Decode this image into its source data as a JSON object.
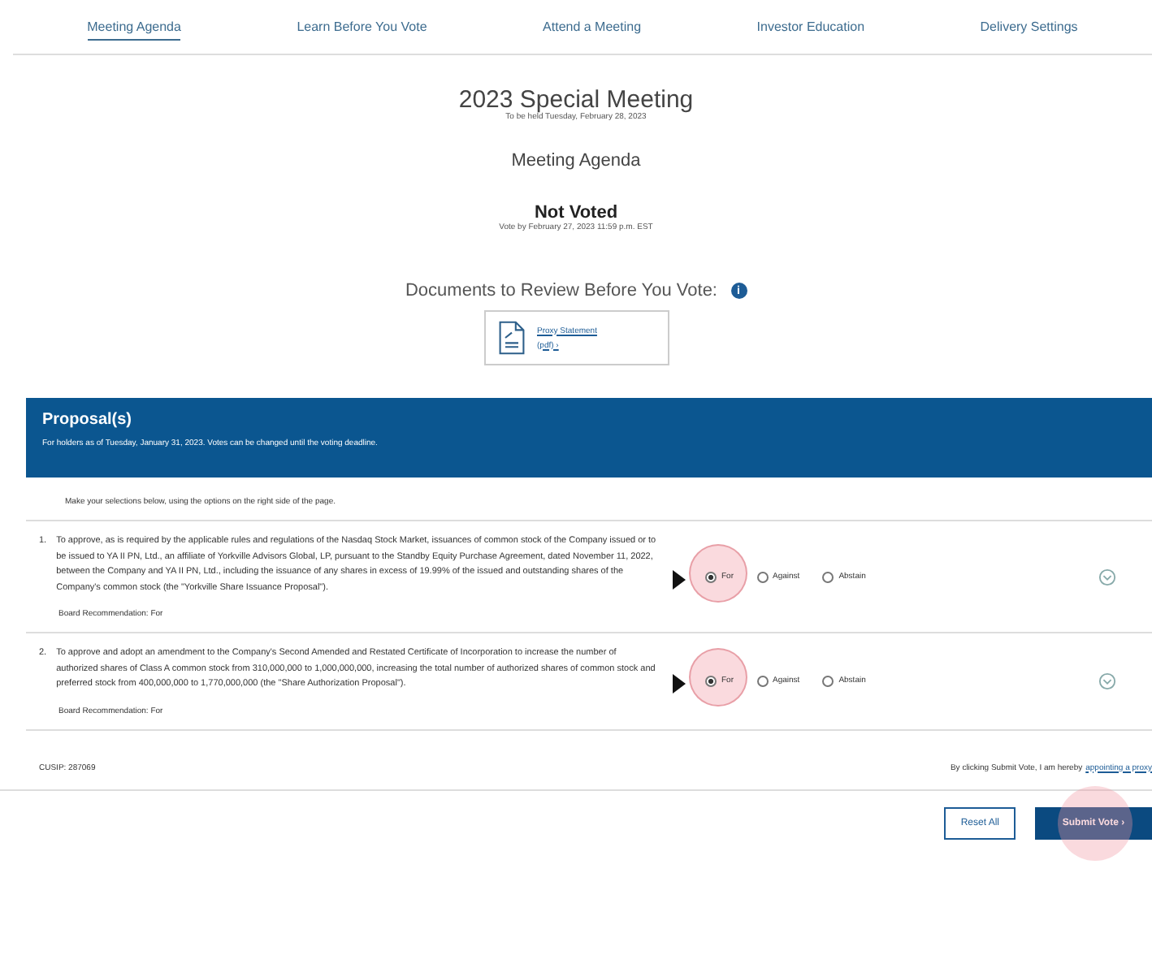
{
  "tabs": [
    {
      "label": "Meeting Agenda",
      "selected": true
    },
    {
      "label": "Learn Before You Vote",
      "selected": false
    },
    {
      "label": "Attend a Meeting",
      "selected": false
    },
    {
      "label": "Investor Education",
      "selected": false
    },
    {
      "label": "Delivery Settings",
      "selected": false
    }
  ],
  "header": {
    "title": "2023 Special Meeting",
    "subtitle": "To be held Tuesday, February 28, 2023",
    "section": "Meeting Agenda",
    "status": "Not Voted",
    "deadline": "Vote by February 27, 2023 11:59 p.m. EST"
  },
  "documents": {
    "heading": "Documents to Review Before You Vote:",
    "info": "i",
    "items": [
      {
        "title": "Proxy Statement",
        "link": "(pdf) ›"
      }
    ]
  },
  "proposals_banner": {
    "title": "Proposal(s)",
    "note": "For holders as of Tuesday, January 31, 2023. Votes can be changed until the voting deadline."
  },
  "instructions": "Make your selections below, using the options on the right side of the page.",
  "proposals": [
    {
      "number": "1.",
      "text": "To approve, as is required by the applicable rules and regulations of the Nasdaq Stock Market, issuances of common stock of the Company issued or to be issued to YA II PN, Ltd., an affiliate of Yorkville Advisors Global, LP, pursuant to the Standby Equity Purchase Agreement, dated November 11, 2022, between the Company and YA II PN, Ltd., including the issuance of any shares in excess of 19.99% of the issued and outstanding shares of the Company's common stock (the \"Yorkville Share Issuance Proposal\").",
      "recommendation": "Board Recommendation:  For",
      "highlighted": true,
      "options": [
        {
          "label": "For",
          "selected": true
        },
        {
          "label": "Against",
          "selected": false
        },
        {
          "label": "Abstain",
          "selected": false
        }
      ]
    },
    {
      "number": "2.",
      "text": "To approve and adopt an amendment to the Company's Second Amended and Restated Certificate of Incorporation to increase the number of authorized shares of Class A common stock from 310,000,000 to 1,000,000,000, increasing the total number of authorized shares of common stock and preferred stock from 400,000,000 to 1,770,000,000 (the \"Share Authorization Proposal\").",
      "recommendation": "Board Recommendation:  For",
      "highlighted": true,
      "options": [
        {
          "label": "For",
          "selected": true
        },
        {
          "label": "Against",
          "selected": false
        },
        {
          "label": "Abstain",
          "selected": false
        }
      ]
    }
  ],
  "cusip": "CUSIP: 287069",
  "consent": {
    "text": "By clicking Submit Vote, I am hereby",
    "link": "appointing a proxy"
  },
  "buttons": [
    {
      "label": "Reset All",
      "kind": "secondary",
      "highlighted": false
    },
    {
      "label": "Submit Vote ›",
      "kind": "primary",
      "highlighted": true
    }
  ]
}
